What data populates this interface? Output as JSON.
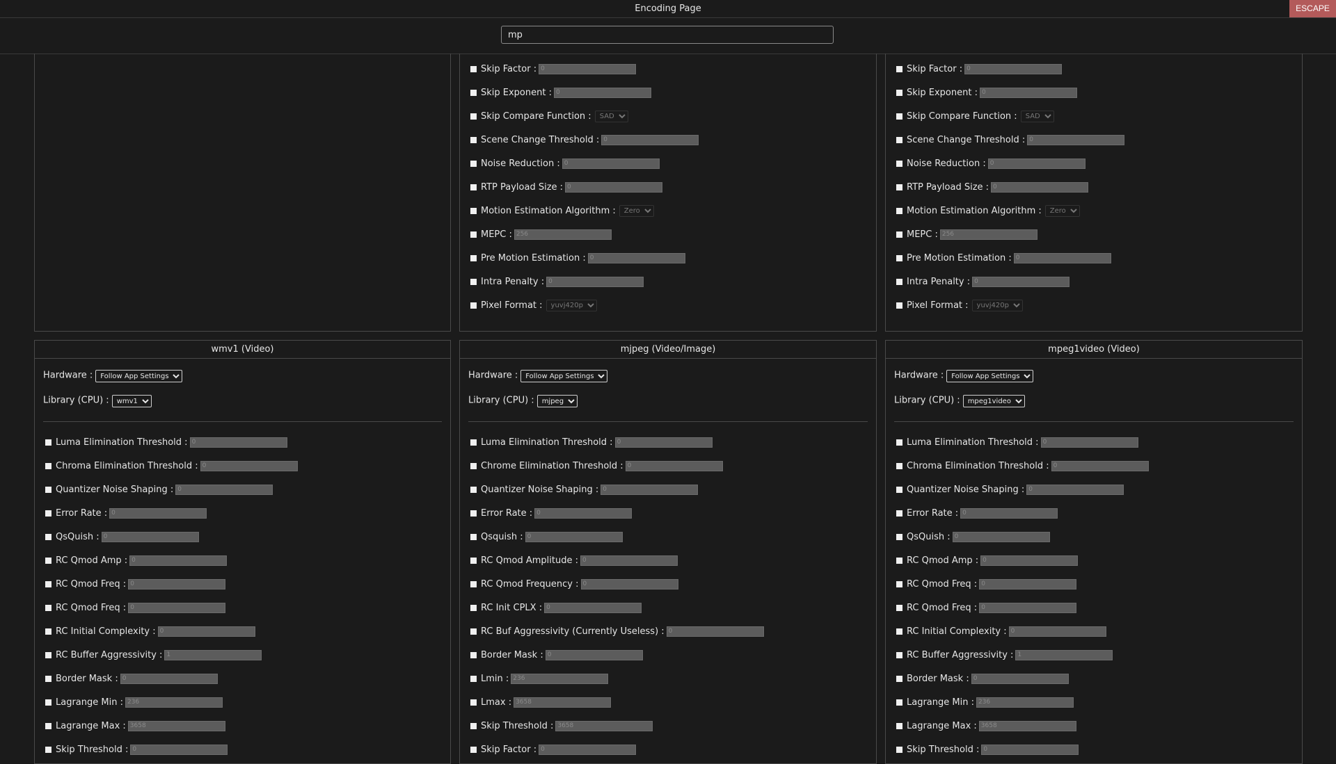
{
  "window": {
    "title": "Encoding Page",
    "escape_label": "ESCAPE"
  },
  "search": {
    "value": "mp"
  },
  "top_panels": [
    {
      "options": []
    },
    {
      "options": [
        {
          "label": "Skip Factor :",
          "type": "input",
          "value": "0"
        },
        {
          "label": "Skip Exponent :",
          "type": "input",
          "value": "0"
        },
        {
          "label": "Skip Compare Function :",
          "type": "select",
          "value": "SAD"
        },
        {
          "label": "Scene Change Threshold :",
          "type": "input",
          "value": "0"
        },
        {
          "label": "Noise Reduction :",
          "type": "input",
          "value": "0"
        },
        {
          "label": "RTP Payload Size :",
          "type": "input",
          "value": "0"
        },
        {
          "label": "Motion Estimation Algorithm :",
          "type": "select",
          "value": "Zero"
        },
        {
          "label": "MEPC :",
          "type": "input",
          "value": "256"
        },
        {
          "label": "Pre Motion Estimation :",
          "type": "input",
          "value": "0"
        },
        {
          "label": "Intra Penalty :",
          "type": "input",
          "value": "0"
        },
        {
          "label": "Pixel Format :",
          "type": "select",
          "value": "yuvj420p"
        }
      ]
    },
    {
      "options": [
        {
          "label": "Skip Factor :",
          "type": "input",
          "value": "0"
        },
        {
          "label": "Skip Exponent :",
          "type": "input",
          "value": "0"
        },
        {
          "label": "Skip Compare Function :",
          "type": "select",
          "value": "SAD"
        },
        {
          "label": "Scene Change Threshold :",
          "type": "input",
          "value": "0"
        },
        {
          "label": "Noise Reduction :",
          "type": "input",
          "value": "0"
        },
        {
          "label": "RTP Payload Size :",
          "type": "input",
          "value": "0"
        },
        {
          "label": "Motion Estimation Algorithm :",
          "type": "select",
          "value": "Zero"
        },
        {
          "label": "MEPC :",
          "type": "input",
          "value": "256"
        },
        {
          "label": "Pre Motion Estimation :",
          "type": "input",
          "value": "0"
        },
        {
          "label": "Intra Penalty :",
          "type": "input",
          "value": "0"
        },
        {
          "label": "Pixel Format :",
          "type": "select",
          "value": "yuvj420p"
        }
      ]
    }
  ],
  "codec_panels": [
    {
      "title": "wmv1 (Video)",
      "hardware_label": "Hardware :",
      "hardware_value": "Follow App Settings",
      "library_label": "Library (CPU) :",
      "library_value": "wmv1",
      "options": [
        {
          "label": "Luma Elimination Threshold :",
          "type": "input",
          "value": "0"
        },
        {
          "label": "Chroma Elimination Threshold :",
          "type": "input",
          "value": "0"
        },
        {
          "label": "Quantizer Noise Shaping :",
          "type": "input",
          "value": "0"
        },
        {
          "label": "Error Rate :",
          "type": "input",
          "value": "0"
        },
        {
          "label": "QsQuish :",
          "type": "input",
          "value": "0"
        },
        {
          "label": "RC Qmod Amp :",
          "type": "input",
          "value": "0"
        },
        {
          "label": "RC Qmod Freq :",
          "type": "input",
          "value": "0"
        },
        {
          "label": "RC Qmod Freq :",
          "type": "input",
          "value": "0"
        },
        {
          "label": "RC Initial Complexity :",
          "type": "input",
          "value": "0"
        },
        {
          "label": "RC Buffer Aggressivity :",
          "type": "input",
          "value": "1"
        },
        {
          "label": "Border Mask :",
          "type": "input",
          "value": "0"
        },
        {
          "label": "Lagrange Min :",
          "type": "input",
          "value": "236"
        },
        {
          "label": "Lagrange Max :",
          "type": "input",
          "value": "3658"
        },
        {
          "label": "Skip Threshold :",
          "type": "input",
          "value": "0"
        }
      ]
    },
    {
      "title": "mjpeg (Video/Image)",
      "hardware_label": "Hardware :",
      "hardware_value": "Follow App Settings",
      "library_label": "Library (CPU) :",
      "library_value": "mjpeg",
      "options": [
        {
          "label": "Luma Elimination Threshold :",
          "type": "input",
          "value": "0"
        },
        {
          "label": "Chrome Elimination Threshold :",
          "type": "input",
          "value": "0"
        },
        {
          "label": "Quantizer Noise Shaping :",
          "type": "input",
          "value": "0"
        },
        {
          "label": "Error Rate :",
          "type": "input",
          "value": "0"
        },
        {
          "label": "Qsquish :",
          "type": "input",
          "value": "0"
        },
        {
          "label": "RC Qmod Amplitude :",
          "type": "input",
          "value": "0"
        },
        {
          "label": "RC Qmod Frequency :",
          "type": "input",
          "value": "0"
        },
        {
          "label": "RC Init CPLX :",
          "type": "input",
          "value": "0"
        },
        {
          "label": "RC Buf Aggressivity (Currently Useless) :",
          "type": "input",
          "value": "0"
        },
        {
          "label": "Border Mask :",
          "type": "input",
          "value": "0"
        },
        {
          "label": "Lmin :",
          "type": "input",
          "value": "236"
        },
        {
          "label": "Lmax :",
          "type": "input",
          "value": "3658"
        },
        {
          "label": "Skip Threshold :",
          "type": "input",
          "value": "3658"
        },
        {
          "label": "Skip Factor :",
          "type": "input",
          "value": "0"
        }
      ]
    },
    {
      "title": "mpeg1video (Video)",
      "hardware_label": "Hardware :",
      "hardware_value": "Follow App Settings",
      "library_label": "Library (CPU) :",
      "library_value": "mpeg1video",
      "options": [
        {
          "label": "Luma Elimination Threshold :",
          "type": "input",
          "value": "0"
        },
        {
          "label": "Chroma Elimination Threshold :",
          "type": "input",
          "value": "0"
        },
        {
          "label": "Quantizer Noise Shaping :",
          "type": "input",
          "value": "0"
        },
        {
          "label": "Error Rate :",
          "type": "input",
          "value": "0"
        },
        {
          "label": "QsQuish :",
          "type": "input",
          "value": "0"
        },
        {
          "label": "RC Qmod Amp :",
          "type": "input",
          "value": "0"
        },
        {
          "label": "RC Qmod Freq :",
          "type": "input",
          "value": "0"
        },
        {
          "label": "RC Qmod Freq :",
          "type": "input",
          "value": "0"
        },
        {
          "label": "RC Initial Complexity :",
          "type": "input",
          "value": "0"
        },
        {
          "label": "RC Buffer Aggressivity :",
          "type": "input",
          "value": "1"
        },
        {
          "label": "Border Mask :",
          "type": "input",
          "value": "0"
        },
        {
          "label": "Lagrange Min :",
          "type": "input",
          "value": "236"
        },
        {
          "label": "Lagrange Max :",
          "type": "input",
          "value": "3658"
        },
        {
          "label": "Skip Threshold :",
          "type": "input",
          "value": "0"
        }
      ]
    }
  ]
}
